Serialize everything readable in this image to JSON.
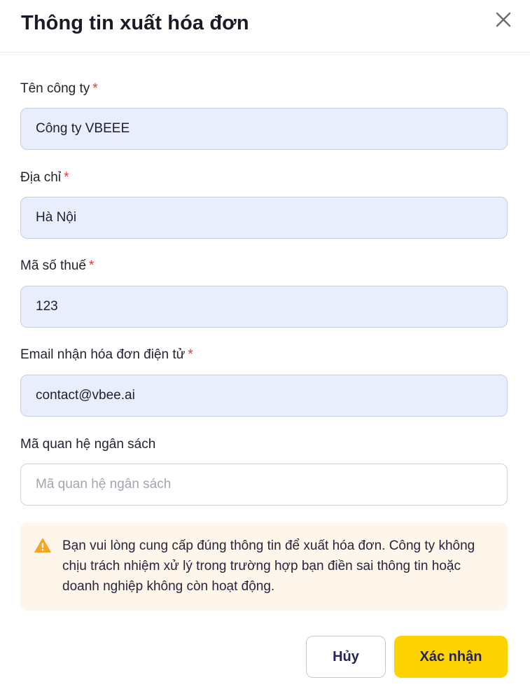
{
  "dialog": {
    "title": "Thông tin xuất hóa đơn"
  },
  "fields": {
    "company_name": {
      "label": "Tên công ty",
      "required_mark": "*",
      "value": "Công ty VBEEE"
    },
    "address": {
      "label": "Địa chỉ",
      "required_mark": "*",
      "value": "Hà Nội"
    },
    "tax_code": {
      "label": "Mã số thuế",
      "required_mark": "*",
      "value": "123"
    },
    "email": {
      "label": "Email nhận hóa đơn điện tử",
      "required_mark": "*",
      "value": "contact@vbee.ai"
    },
    "budget_code": {
      "label": "Mã quan hệ ngân sách",
      "value": "",
      "placeholder": "Mã quan hệ ngân sách"
    }
  },
  "notice": {
    "icon": "warning-icon",
    "text": "Bạn vui lòng cung cấp đúng thông tin để xuất hóa đơn. Công ty không chịu trách nhiệm xử lý trong trường hợp bạn điền sai thông tin hoặc doanh nghiệp không còn hoạt động."
  },
  "actions": {
    "cancel_label": "Hủy",
    "confirm_label": "Xác nhận"
  },
  "colors": {
    "accent": "#fdd300",
    "filled_input_bg": "#e8eefc",
    "required": "#e53935",
    "warning": "#f5a623",
    "notice_bg": "#fff6eb"
  }
}
